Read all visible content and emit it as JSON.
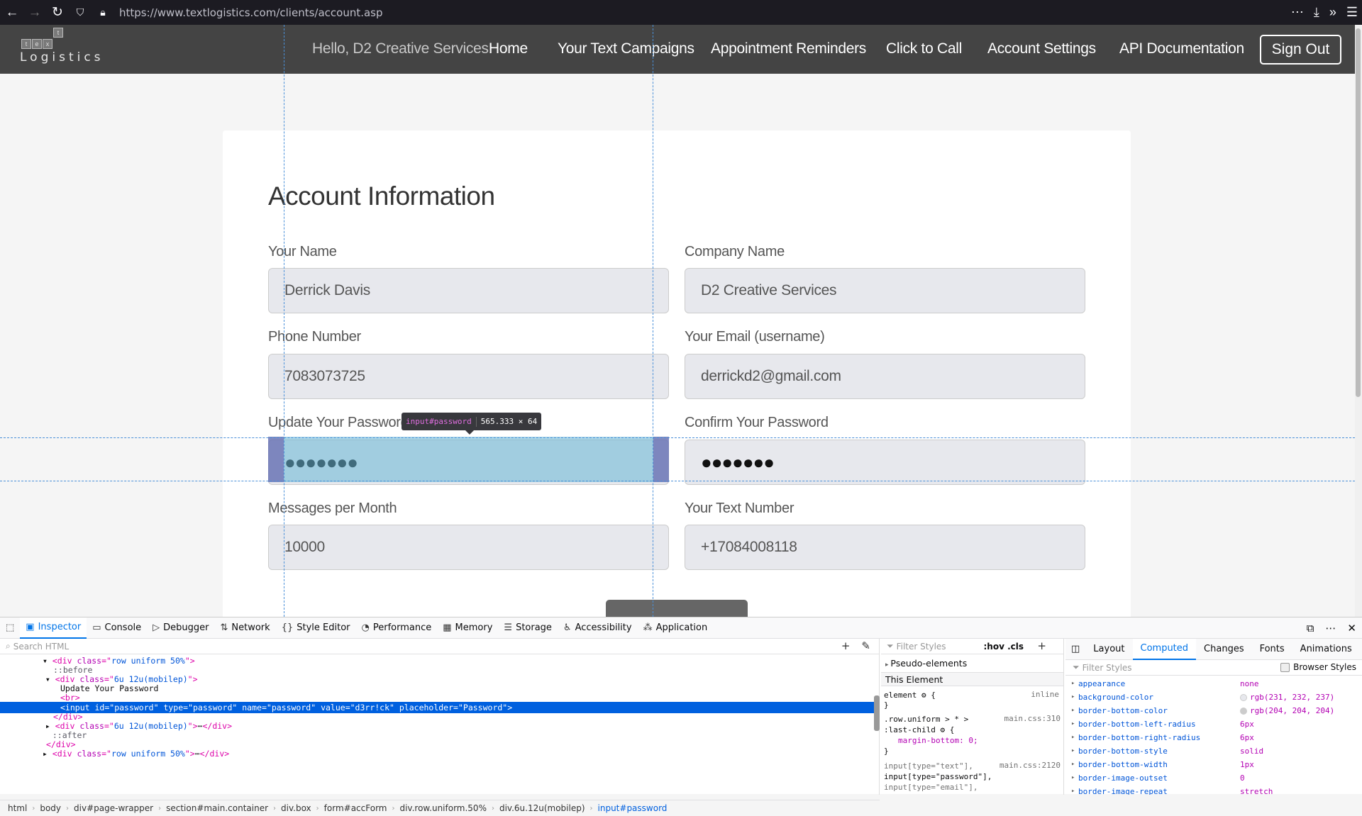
{
  "browser": {
    "url": "https://www.textlogistics.com/clients/account.asp"
  },
  "site": {
    "logo_letters": [
      "t",
      "e",
      "x",
      "t"
    ],
    "logo_text": "Logistics",
    "greeting": "Hello, D2 Creative Services!",
    "nav": [
      "Home",
      "Your Text Campaigns",
      "Appointment Reminders",
      "Click to Call",
      "Account Settings",
      "API Documentation"
    ],
    "sign_out": "Sign Out"
  },
  "form": {
    "title": "Account Information",
    "fields": {
      "name": {
        "label": "Your Name",
        "value": "Derrick Davis"
      },
      "company": {
        "label": "Company Name",
        "value": "D2 Creative Services"
      },
      "phone": {
        "label": "Phone Number",
        "value": "7083073725"
      },
      "email": {
        "label": "Your Email (username)",
        "value": "derrickd2@gmail.com"
      },
      "password": {
        "label": "Update Your Password",
        "value": "●●●●●●●"
      },
      "confirm": {
        "label": "Confirm Your Password",
        "value": "●●●●●●●"
      },
      "messages": {
        "label": "Messages per Month",
        "value": "10000"
      },
      "textnumber": {
        "label": "Your Text Number",
        "value": "+17084008118"
      }
    }
  },
  "inspector_overlay": {
    "tag": "input",
    "id": "#password",
    "size": "565.333 × 64"
  },
  "devtools": {
    "tabs": [
      "Inspector",
      "Console",
      "Debugger",
      "Network",
      "Style Editor",
      "Performance",
      "Memory",
      "Storage",
      "Accessibility",
      "Application"
    ],
    "active_tab": "Inspector",
    "search_placeholder": "Search HTML",
    "html_lines": [
      {
        "indent": "    ",
        "tw": "▾",
        "parts": [
          [
            "tg",
            "<div "
          ],
          [
            "at",
            "class"
          ],
          [
            "tg",
            "=\""
          ],
          [
            "av",
            "row uniform 50%"
          ],
          [
            "tg",
            "\">"
          ]
        ]
      },
      {
        "indent": "      ",
        "tw": "",
        "parts": [
          [
            "ps",
            "::before"
          ]
        ]
      },
      {
        "indent": "    ",
        "tw": "  ▾",
        "parts": [
          [
            "tg",
            "<div "
          ],
          [
            "at",
            "class"
          ],
          [
            "tg",
            "=\""
          ],
          [
            "av",
            "6u 12u(mobilep)"
          ],
          [
            "tg",
            "\">"
          ]
        ]
      },
      {
        "indent": "            ",
        "tw": "",
        "parts": [
          [
            "",
            "Update Your Password"
          ]
        ]
      },
      {
        "indent": "            ",
        "tw": "",
        "parts": [
          [
            "tg",
            "<br>"
          ]
        ]
      },
      {
        "indent": "            ",
        "tw": "",
        "parts": [
          [
            "tg",
            "<input "
          ],
          [
            "at",
            "id"
          ],
          [
            "tg",
            "=\""
          ],
          [
            "av",
            "password"
          ],
          [
            "tg",
            "\" "
          ],
          [
            "at",
            "type"
          ],
          [
            "tg",
            "=\""
          ],
          [
            "av",
            "password"
          ],
          [
            "tg",
            "\" "
          ],
          [
            "at",
            "name"
          ],
          [
            "tg",
            "=\""
          ],
          [
            "av",
            "password"
          ],
          [
            "tg",
            "\" "
          ],
          [
            "at",
            "value"
          ],
          [
            "tg",
            "=\""
          ],
          [
            "av",
            "d3rr!ck"
          ],
          [
            "tg",
            "\" "
          ],
          [
            "at",
            "placeholder"
          ],
          [
            "tg",
            "=\""
          ],
          [
            "av",
            "Password"
          ],
          [
            "tg",
            "\">"
          ]
        ]
      },
      {
        "indent": "          ",
        "tw": "",
        "parts": [
          [
            "tg",
            "</div>"
          ]
        ]
      },
      {
        "indent": "      ",
        "tw": "  ▸",
        "parts": [
          [
            "tg",
            "<div "
          ],
          [
            "at",
            "class"
          ],
          [
            "tg",
            "=\""
          ],
          [
            "av",
            "6u 12u(mobilep)"
          ],
          [
            "tg",
            "\">"
          ],
          [
            "",
            "⋯"
          ],
          [
            "tg",
            "</div>"
          ]
        ]
      },
      {
        "indent": "      ",
        "tw": "",
        "parts": [
          [
            "ps",
            "  ::after"
          ]
        ]
      },
      {
        "indent": "        ",
        "tw": "",
        "parts": [
          [
            "tg",
            "</div>"
          ]
        ]
      },
      {
        "indent": "    ",
        "tw": "▸",
        "parts": [
          [
            "tg",
            "<div "
          ],
          [
            "at",
            "class"
          ],
          [
            "tg",
            "=\""
          ],
          [
            "av",
            "row uniform 50%"
          ],
          [
            "tg",
            "\">"
          ],
          [
            "",
            "⋯"
          ],
          [
            "tg",
            "</div>"
          ]
        ]
      }
    ],
    "breadcrumbs": [
      "html",
      "body",
      "div#page-wrapper",
      "section#main.container",
      "div.box",
      "form#accForm",
      "div.row.uniform.50%",
      "div.6u.12u(mobilep)",
      "input#password"
    ],
    "rules": {
      "filter_placeholder": "Filter Styles",
      "hov_cls": ":hov .cls",
      "pseudo": "Pseudo-elements",
      "this_element": "This Element",
      "element_rule": "element ⚙ {",
      "element_src": "inline",
      "element_close": "}",
      "rule2_sel1": ".row.uniform > * >",
      "rule2_sel2": ":last-child ⚙ {",
      "rule2_src": "main.css:310",
      "rule2_decl": "margin-bottom: 0;",
      "rule2_close": "}",
      "rule3_sel": "input[type=\"text\"],",
      "rule3_src": "main.css:2120",
      "rule3_sel2": "input[type=\"password\"],",
      "rule3_sel3": "input[type=\"email\"],"
    },
    "computed_tabs": [
      "Layout",
      "Computed",
      "Changes",
      "Fonts",
      "Animations"
    ],
    "computed_active": "Computed",
    "computed_filter": "Filter Styles",
    "browser_styles": "Browser Styles",
    "computed_props": [
      {
        "name": "appearance",
        "value": "none",
        "swatch": ""
      },
      {
        "name": "background-color",
        "value": "rgb(231, 232, 237)",
        "swatch": "#e7e8ed"
      },
      {
        "name": "border-bottom-color",
        "value": "rgb(204, 204, 204)",
        "swatch": "#cccccc"
      },
      {
        "name": "border-bottom-left-radius",
        "value": "6px",
        "swatch": ""
      },
      {
        "name": "border-bottom-right-radius",
        "value": "6px",
        "swatch": ""
      },
      {
        "name": "border-bottom-style",
        "value": "solid",
        "swatch": ""
      },
      {
        "name": "border-bottom-width",
        "value": "1px",
        "swatch": ""
      },
      {
        "name": "border-image-outset",
        "value": "0",
        "swatch": ""
      },
      {
        "name": "border-image-repeat",
        "value": "stretch",
        "swatch": ""
      }
    ]
  }
}
